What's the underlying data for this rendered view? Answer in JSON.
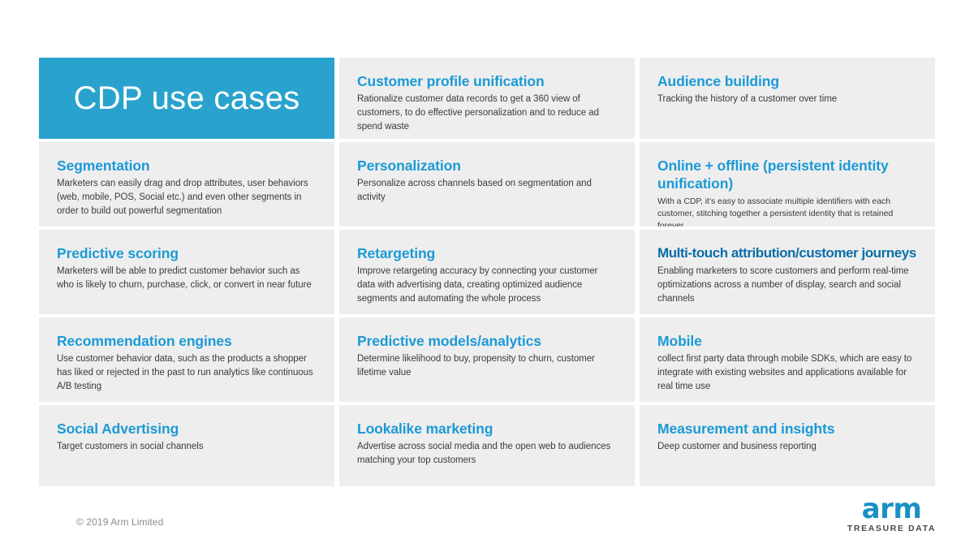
{
  "slide": {
    "title": "CDP use cases",
    "accent_color": "#29a3cd",
    "heading_color": "#1b9ad6",
    "heading_color_dark": "#0b6ea8",
    "cell_background": "#eeeeee",
    "body_color": "#3b3b3b"
  },
  "cells": [
    {
      "heading": "Customer profile unification",
      "body": "Rationalize customer data records to get a 360 view of customers, to do effective personalization and to reduce ad spend waste"
    },
    {
      "heading": "Audience building",
      "body": "Tracking the history of a customer over time"
    },
    {
      "heading": "Segmentation",
      "body": "Marketers can easily drag and drop attributes, user behaviors (web, mobile, POS, Social etc.) and even other segments in order to build out powerful segmentation"
    },
    {
      "heading": "Personalization",
      "body": "Personalize across channels based on segmentation and activity"
    },
    {
      "heading": "Online + offline (persistent identity unification)",
      "body": "With a CDP, it’s easy to associate multiple identifiers with each customer, stitching together a persistent identity that is retained forever"
    },
    {
      "heading": "Predictive scoring",
      "body": "Marketers will be able to predict customer behavior such as who is likely to churn, purchase, click, or convert in near future"
    },
    {
      "heading": "Retargeting",
      "body": "Improve retargeting accuracy by connecting your customer data with advertising data, creating optimized audience segments and automating the whole process"
    },
    {
      "heading": "Multi-touch attribution/customer journeys",
      "body": "Enabling marketers to score customers and perform real-time optimizations across a number of display, search and social channels"
    },
    {
      "heading": "Recommendation engines",
      "body": "Use customer behavior data, such as the products a shopper has liked or rejected in the past to run analytics like continuous A/B testing"
    },
    {
      "heading": "Predictive models/analytics",
      "body": "Determine likelihood to buy, propensity to churn, customer lifetime value"
    },
    {
      "heading": "Mobile",
      "body": "collect first party data through mobile SDKs, which are easy to integrate with existing websites and applications available for real time use"
    },
    {
      "heading": "Social Advertising",
      "body": "Target customers in social channels"
    },
    {
      "heading": "Lookalike marketing",
      "body": "Advertise across social media and the open web to audiences matching your top customers"
    },
    {
      "heading": "Measurement and insights",
      "body": "Deep customer and business reporting"
    }
  ],
  "footer": {
    "copyright": "© 2019 Arm Limited",
    "logo_wordmark": "arm",
    "logo_subtitle": "TREASURE DATA"
  }
}
